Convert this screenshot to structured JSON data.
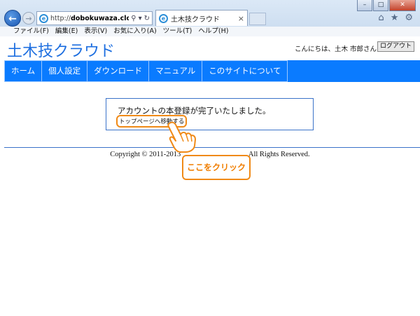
{
  "browser": {
    "url_prefix": "http://",
    "url_domain": "dobokuwaza.cloudap...",
    "url_host": "dobokuwaza",
    "url_rest": ".cloudap...",
    "tab_title": "土木技クラウド",
    "menu": [
      "ファイル(F)",
      "編集(E)",
      "表示(V)",
      "お気に入り(A)",
      "ツール(T)",
      "ヘルプ(H)"
    ],
    "icons": [
      "home-icon",
      "star-icon",
      "gear-icon"
    ]
  },
  "site": {
    "logo": "土木技クラウド",
    "greeting": "こんにちは、土木 市郎さん",
    "logout": "ログアウト",
    "nav": [
      "ホーム",
      "個人設定",
      "ダウンロード",
      "マニュアル",
      "このサイトについて"
    ],
    "nav_color": "#0a7bff"
  },
  "main": {
    "message": "アカウントの本登録が完了いたしました。",
    "top_link": "トップページへ移動する",
    "copyright_left": "Copyright © 2011-2013",
    "copyright_right": "All Rights Reserved."
  },
  "overlay": {
    "callout": "ここをクリック",
    "accent": "#f08a17"
  }
}
